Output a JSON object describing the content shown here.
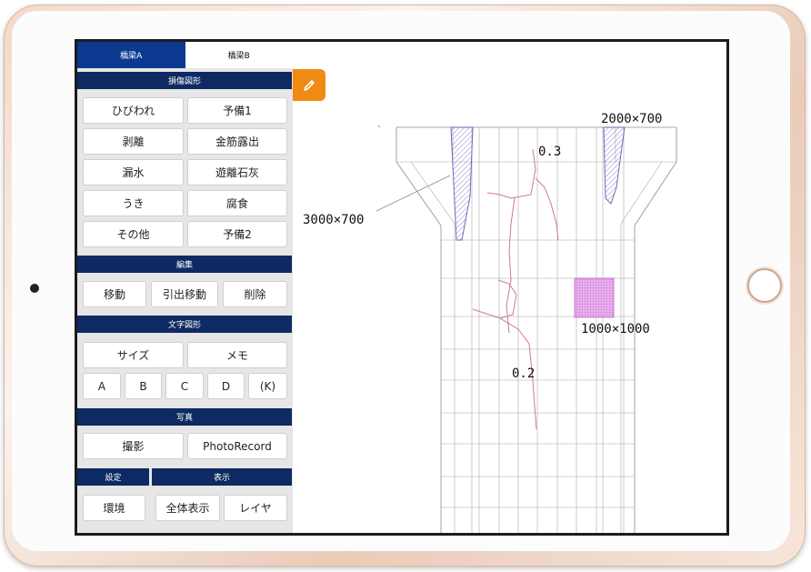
{
  "tabs": [
    {
      "label": "橋梁A",
      "active": true
    },
    {
      "label": "橋梁B",
      "active": false
    }
  ],
  "sections": {
    "damage": "損傷図形",
    "edit": "編集",
    "text_shapes": "文字図形",
    "photo": "写真",
    "settings": "設定",
    "display": "表示"
  },
  "damage_buttons": [
    "ひびわれ",
    "予備1",
    "剥離",
    "金筋露出",
    "漏水",
    "遊離石灰",
    "うき",
    "腐食",
    "その他",
    "予備2"
  ],
  "edit_buttons": [
    "移動",
    "引出移動",
    "削除"
  ],
  "text_buttons": {
    "size": "サイズ",
    "memo": "メモ",
    "letters": [
      "A",
      "B",
      "C",
      "D",
      "(K)"
    ]
  },
  "photo_buttons": [
    "撮影",
    "PhotoRecord"
  ],
  "settings_buttons": [
    "環境",
    "全体表示",
    "レイヤ"
  ],
  "tool_icon": "pencil-icon",
  "drawing_labels": {
    "left_hatch": "3000×700",
    "right_hatch": "2000×700",
    "crack_top": "0.3",
    "patch": "1000×1000",
    "crack_bottom": "0.2"
  },
  "colors": {
    "tab_active": "#0b3990",
    "section_header": "#0d2a62",
    "tool_button": "#ef8a13",
    "hatch": "#6a6ac0",
    "crack": "#d07a86",
    "patch": "#d070d8"
  }
}
